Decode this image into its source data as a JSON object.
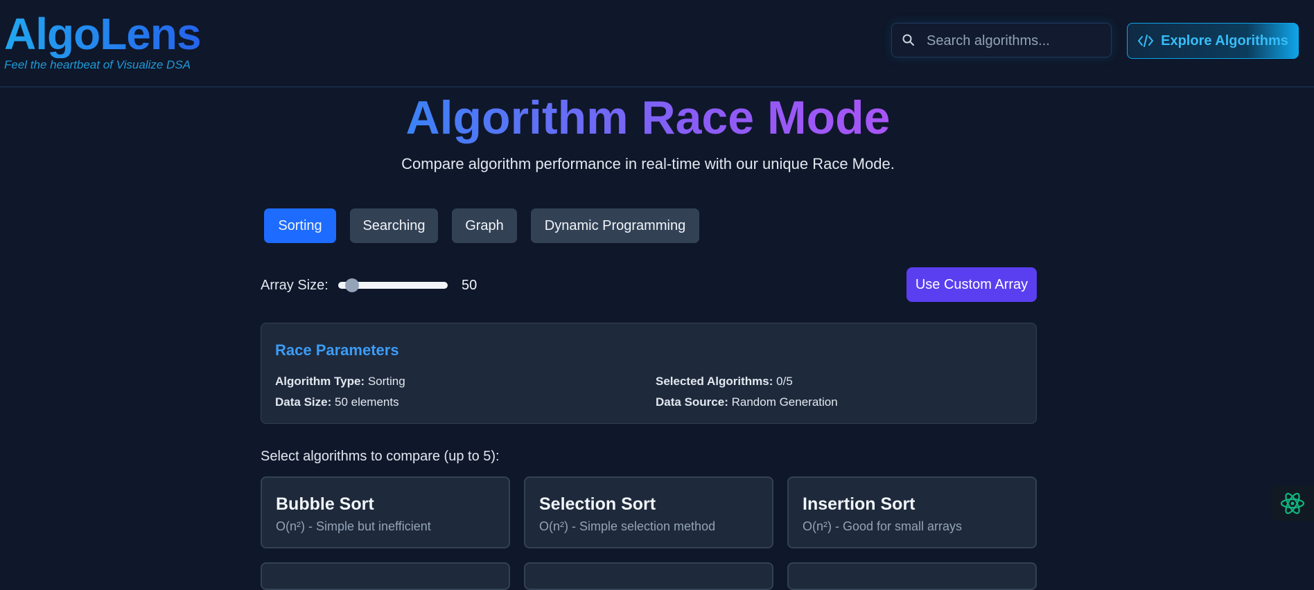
{
  "header": {
    "logo": "AlgoLens",
    "tagline": "Feel the heartbeat of Visualize DSA",
    "search_placeholder": "Search algorithms...",
    "explore_label": "Explore Algorithms"
  },
  "hero": {
    "title": "Algorithm Race Mode",
    "subtitle": "Compare algorithm performance in real-time with our unique Race Mode."
  },
  "tabs": [
    {
      "label": "Sorting",
      "active": true
    },
    {
      "label": "Searching",
      "active": false
    },
    {
      "label": "Graph",
      "active": false
    },
    {
      "label": "Dynamic Programming",
      "active": false
    }
  ],
  "array": {
    "label": "Array Size:",
    "value": "50",
    "slider_fraction": 0.05,
    "custom_button": "Use Custom Array"
  },
  "params": {
    "title": "Race Parameters",
    "algorithm_type_label": "Algorithm Type:",
    "algorithm_type_value": "Sorting",
    "selected_label": "Selected Algorithms:",
    "selected_value": "0/5",
    "data_size_label": "Data Size:",
    "data_size_value": "50 elements",
    "data_source_label": "Data Source:",
    "data_source_value": "Random Generation"
  },
  "select_hint": "Select algorithms to compare (up to 5):",
  "algorithms": [
    {
      "name": "Bubble Sort",
      "description": "O(n²) - Simple but inefficient"
    },
    {
      "name": "Selection Sort",
      "description": "O(n²) - Simple selection method"
    },
    {
      "name": "Insertion Sort",
      "description": "O(n²) - Good for small arrays"
    }
  ],
  "icons": {
    "search": "search-icon",
    "code": "code-icon",
    "assistant": "atom-icon"
  },
  "colors": {
    "background": "#0f172a",
    "accent_blue": "#1d6cff",
    "accent_purple": "#5a3ff0",
    "cyan": "#38bdf8"
  }
}
